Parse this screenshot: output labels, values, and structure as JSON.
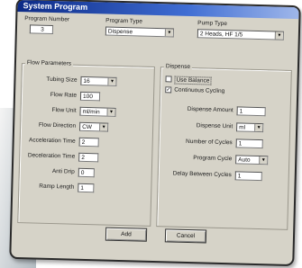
{
  "window": {
    "title": "System Program"
  },
  "header": {
    "program_number": {
      "label": "Program Number",
      "value": "3"
    },
    "program_type": {
      "label": "Program Type",
      "value": "Dispense"
    },
    "pump_type": {
      "label": "Pump Type",
      "value": "2 Heads, HF 1/5"
    }
  },
  "flow_parameters": {
    "title": "Flow Parameters",
    "fields": [
      {
        "label": "Tubing Size",
        "value": "16",
        "kind": "select"
      },
      {
        "label": "Flow Rate",
        "value": "100",
        "kind": "input"
      },
      {
        "label": "Flow Unit",
        "value": "ml/min",
        "kind": "select"
      },
      {
        "label": "Flow Direction",
        "value": "CW",
        "kind": "select"
      },
      {
        "label": "Acceleration Time",
        "value": "2",
        "kind": "input"
      },
      {
        "label": "Deceleration Time",
        "value": "2",
        "kind": "input"
      },
      {
        "label": "Anti Drip",
        "value": "0",
        "kind": "input"
      },
      {
        "label": "Ramp Length",
        "value": "1",
        "kind": "input"
      }
    ]
  },
  "dispense": {
    "title": "Dispense",
    "use_balance": {
      "label": "Use Balance",
      "checked": false
    },
    "continuous_cycling": {
      "label": "Continuous Cycling",
      "checked": true
    },
    "fields": [
      {
        "label": "Dispense Amount",
        "value": "1",
        "kind": "input"
      },
      {
        "label": "Dispense Unit",
        "value": "ml",
        "kind": "select"
      },
      {
        "label": "Number of Cycles",
        "value": "1",
        "kind": "input"
      },
      {
        "label": "Program Cycle",
        "value": "Auto",
        "kind": "select"
      },
      {
        "label": "Delay Between Cycles",
        "value": "1",
        "kind": "input"
      }
    ]
  },
  "buttons": {
    "add": "Add",
    "cancel": "Cancel"
  }
}
